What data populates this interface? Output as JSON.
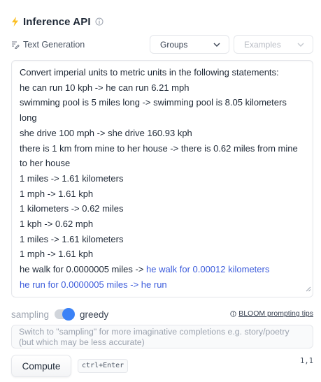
{
  "header": {
    "title": "Inference API",
    "bolt_icon_color": "#fbbf24"
  },
  "task": {
    "label": "Text Generation"
  },
  "dropdowns": {
    "groups": {
      "selected": "Groups"
    },
    "examples": {
      "placeholder": "Examples"
    }
  },
  "editor": {
    "lines": [
      "Convert imperial units to metric units in the following statements:",
      "he can run 10 kph -> he can run 6.21 mph",
      "swimming pool is 5 miles long -> swimming pool is 8.05 kilometers",
      "long",
      "she drive 100 mph -> she drive 160.93 kph",
      "there is 1 km from mine to her house -> there is 0.62 miles from mine",
      "to her house",
      "1 miles -> 1.61 kilometers",
      "1 mph -> 1.61 kph",
      "1 kilometers -> 0.62 miles",
      "1 kph -> 0.62 mph",
      "1 miles -> 1.61 kilometers",
      "1 mph -> 1.61 kph"
    ],
    "prompt_tail": "he walk for 0.0000005 miles -> ",
    "generated_inline": "he walk for 0.00012 kilometers",
    "generated_line": "he run for 0.0000005 miles -> he run",
    "generated_color": "#3b5bdb"
  },
  "mode": {
    "sampling_label": "sampling",
    "greedy_label": "greedy",
    "selected": "greedy",
    "toggle_color": "#3b82f6"
  },
  "tips": {
    "link": "BLOOM prompting tips"
  },
  "hint": {
    "text": "Switch to \"sampling\" for more imaginative completions e.g. story/poetry (but which may be less accurate)"
  },
  "actions": {
    "compute_label": "Compute",
    "shortcut": "ctrl+Enter",
    "cursor_position": "1,1"
  }
}
